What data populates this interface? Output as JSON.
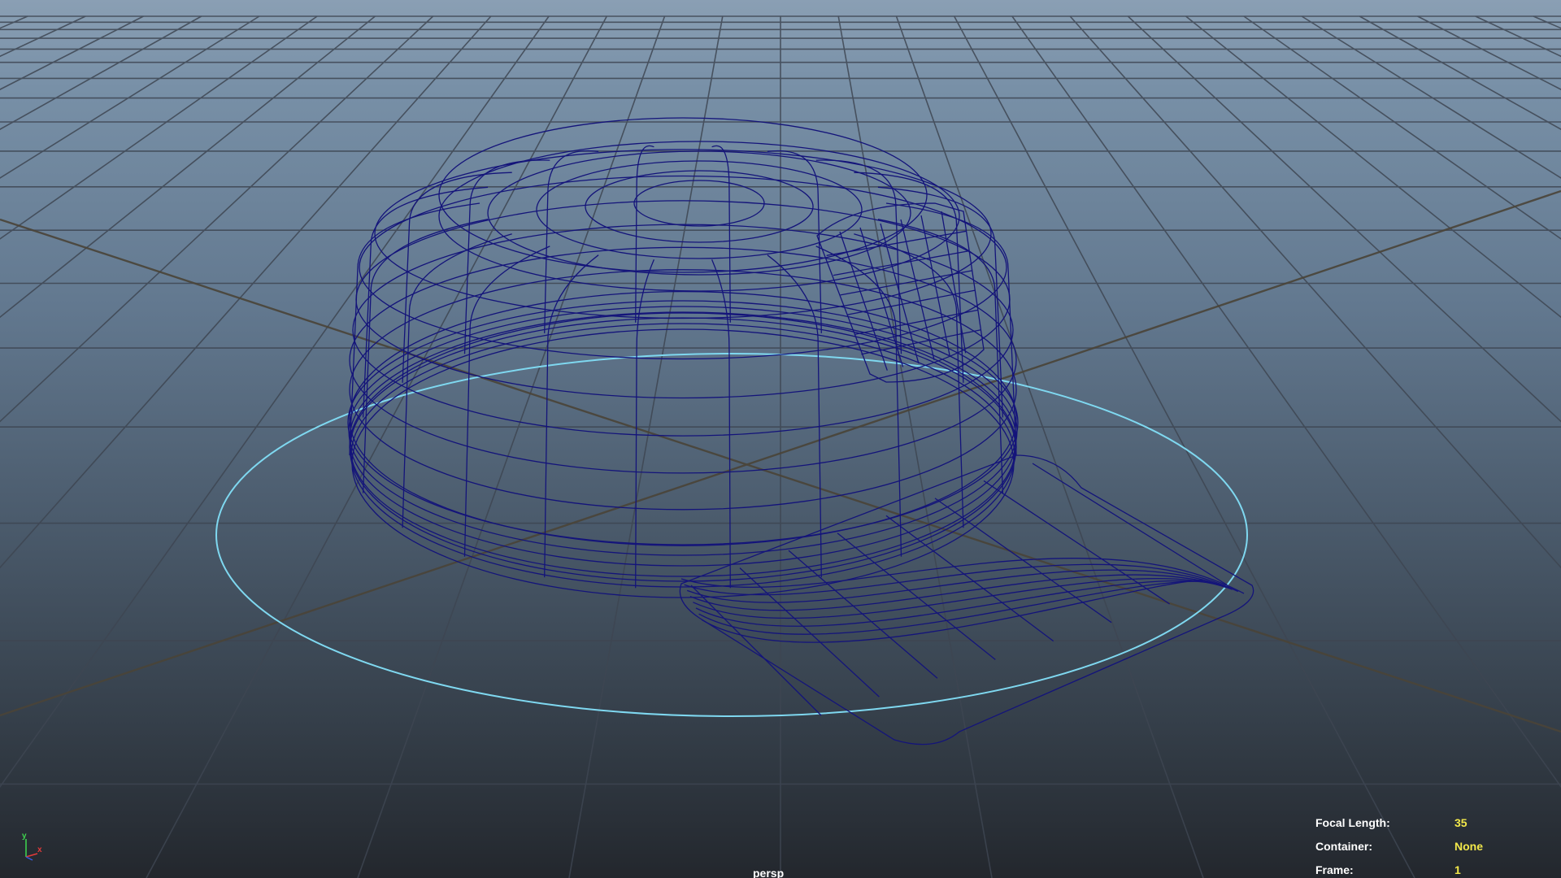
{
  "viewport": {
    "camera_name": "persp",
    "background_top": "#8a9fb4",
    "background_bottom": "#23272d",
    "grid_color": "#3e4652",
    "axis_line_color": "#4a4438",
    "wireframe_color": "#14147a",
    "selection_circle_color": "#7fd8f0"
  },
  "hud": {
    "focal_length_label": "Focal Length:",
    "focal_length_value": "35",
    "container_label": "Container:",
    "container_value": "None",
    "frame_label": "Frame:",
    "frame_value": "1",
    "value_color": "#f2e84a"
  },
  "axis_gizmo": {
    "y_label": "y",
    "x_label": "x",
    "y_color": "#3fd84f",
    "x_color": "#e23a3a",
    "z_color": "#3a5ae0"
  }
}
